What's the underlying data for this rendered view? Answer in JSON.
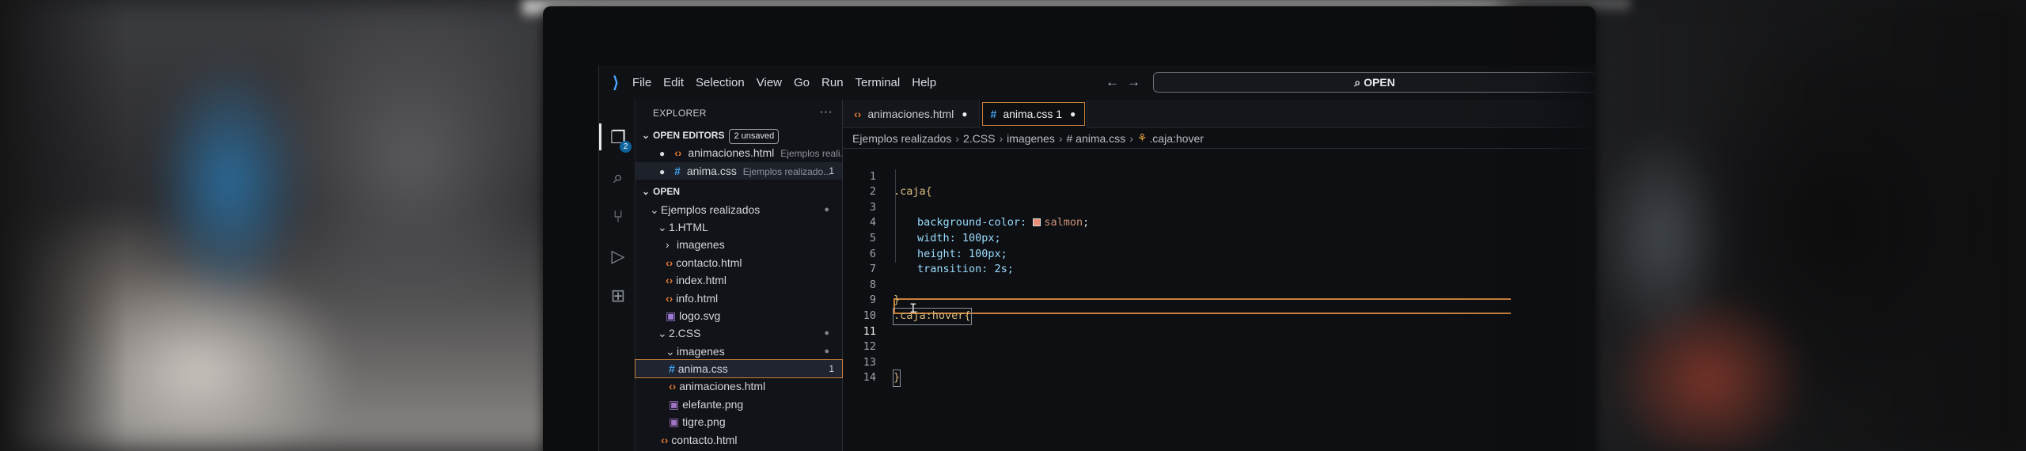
{
  "menubar": {
    "logo_icon": "vscode-logo-icon",
    "items": [
      "File",
      "Edit",
      "Selection",
      "View",
      "Go",
      "Run",
      "Terminal",
      "Help"
    ],
    "nav_back_icon": "arrow-left-icon",
    "nav_forward_icon": "arrow-right-icon",
    "search_text": "OPEN"
  },
  "activity_bar": {
    "icons": [
      "files-icon",
      "search-icon",
      "source-control-icon",
      "run-debug-icon",
      "extensions-icon"
    ],
    "explorer_badge": "2"
  },
  "explorer": {
    "title": "EXPLORER",
    "more_icon": "ellipsis-icon",
    "open_editors_label": "OPEN EDITORS",
    "unsaved_badge": "2 unsaved",
    "open_editors": [
      {
        "name": "animaciones.html",
        "path": "Ejemplos reali...",
        "count": ""
      },
      {
        "name": "anima.css",
        "path": "Ejemplos realizado...",
        "count": "1"
      }
    ],
    "workspace_label": "OPEN",
    "tree": {
      "root": "Ejemplos realizados",
      "folder1": "1.HTML",
      "folder1_sub": "imagenes",
      "contacto": "contacto.html",
      "index": "index.html",
      "info": "info.html",
      "logo": "logo.svg",
      "folder2": "2.CSS",
      "folder2_sub": "imagenes",
      "anima": "anima.css",
      "anima_count": "1",
      "animaciones": "animaciones.html",
      "elefante": "elefante.png",
      "tigre": "tigre.png",
      "contacto2": "contacto.html"
    }
  },
  "editor": {
    "tabs": [
      {
        "label": "animaciones.html"
      },
      {
        "label": "anima.css 1"
      }
    ],
    "breadcrumbs": [
      "Ejemplos realizados",
      "2.CSS",
      "imagenes",
      "# anima.css",
      ".caja:hover"
    ],
    "line_numbers": [
      "1",
      "2",
      "3",
      "4",
      "5",
      "6",
      "7",
      "8",
      "9",
      "10",
      "11",
      "12",
      "13",
      "14"
    ],
    "code": {
      "l1": ".caja{",
      "l3_prop": "background-color: ",
      "l3_val": "salmon",
      "l3_end": ";",
      "l4": "width: 100px;",
      "l5": "height: 100px;",
      "l6": "transition: 2s;",
      "l8": "}",
      "l9": ".caja:hover{",
      "l13": "}"
    },
    "swatch_color": "#e8907a"
  }
}
